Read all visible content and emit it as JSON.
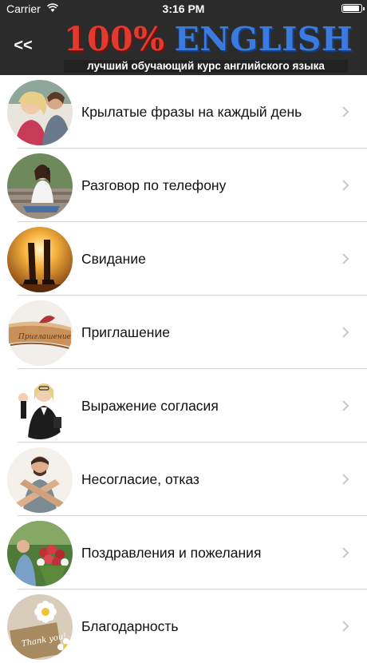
{
  "status_bar": {
    "carrier": "Carrier",
    "time": "3:16 PM"
  },
  "header": {
    "back_label": "<<",
    "logo_part1": "100%",
    "logo_part2": "ENGLISH",
    "tagline": "лучший обучающий курс английского языка"
  },
  "colors": {
    "header_bg": "#2b2b2b",
    "logo_red": "#e33a2f",
    "logo_blue": "#3b7be0",
    "chevron": "#c7c7cc",
    "separator": "#d9d9d9"
  },
  "list": {
    "items": [
      {
        "label": "Крылатые фразы на каждый день",
        "icon": "laughing-friends-photo"
      },
      {
        "label": "Разговор по телефону",
        "icon": "phone-call-photo"
      },
      {
        "label": "Свидание",
        "icon": "date-sunset-photo"
      },
      {
        "label": "Приглашение",
        "icon": "invitation-card-photo"
      },
      {
        "label": "Выражение согласия",
        "icon": "ok-gesture-photo"
      },
      {
        "label": "Несогласие, отказ",
        "icon": "crossed-arms-photo"
      },
      {
        "label": "Поздравления и пожелания",
        "icon": "flowers-congrats-photo"
      },
      {
        "label": "Благодарность",
        "icon": "thank-you-card-photo"
      }
    ]
  },
  "thank_you_text": "Thank you!"
}
